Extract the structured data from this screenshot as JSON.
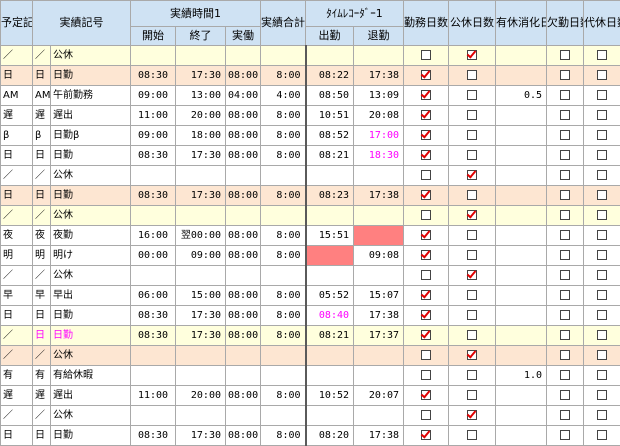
{
  "headers": {
    "plan": "予定記号",
    "actual": "実績記号",
    "time_group": "実績時間1",
    "start": "開始",
    "end": "終了",
    "work": "実働",
    "total": "実績合計",
    "recorder": "ﾀｲﾑﾚｺｰﾀﾞｰ1",
    "clock_in": "出勤",
    "clock_out": "退勤",
    "work_days": "勤務日数",
    "holiday_days": "公休日数",
    "paid_leave": "有休消化日数",
    "absent_days": "欠勤日数",
    "sub_days": "代休日数"
  },
  "rows": [
    {
      "bg": "y",
      "plan": "／",
      "code": "／",
      "name": "公休",
      "start": "",
      "end": "",
      "work": "",
      "total": "",
      "in": "",
      "out": "",
      "paid": "",
      "cb": [
        false,
        true,
        false,
        false
      ]
    },
    {
      "bg": "o",
      "plan": "日",
      "code": "日",
      "name": "日勤",
      "start": "08:30",
      "end": "17:30",
      "work": "08:00",
      "total": "8:00",
      "in": "08:22",
      "out": "17:38",
      "paid": "",
      "cb": [
        true,
        false,
        false,
        false
      ]
    },
    {
      "bg": "w",
      "plan": "AM",
      "code": "AM",
      "name": "午前勤務",
      "start": "09:00",
      "end": "13:00",
      "work": "04:00",
      "total": "4:00",
      "in": "08:50",
      "out": "13:09",
      "paid": "0.5",
      "cb": [
        true,
        false,
        false,
        false
      ]
    },
    {
      "bg": "w",
      "plan": "遅",
      "code": "遅",
      "name": "遅出",
      "start": "11:00",
      "end": "20:00",
      "work": "08:00",
      "total": "8:00",
      "in": "10:51",
      "out": "20:08",
      "paid": "",
      "cb": [
        true,
        false,
        false,
        false
      ]
    },
    {
      "bg": "w",
      "plan": "β",
      "code": "β",
      "name": "日勤β",
      "start": "09:00",
      "end": "18:00",
      "work": "08:00",
      "total": "8:00",
      "in": "08:52",
      "out": "17:00",
      "outMagenta": true,
      "paid": "",
      "cb": [
        true,
        false,
        false,
        false
      ]
    },
    {
      "bg": "w",
      "plan": "日",
      "code": "日",
      "name": "日勤",
      "start": "08:30",
      "end": "17:30",
      "work": "08:00",
      "total": "8:00",
      "in": "08:21",
      "out": "18:30",
      "outMagenta": true,
      "paid": "",
      "cb": [
        true,
        false,
        false,
        false
      ]
    },
    {
      "bg": "w",
      "plan": "／",
      "code": "／",
      "name": "公休",
      "start": "",
      "end": "",
      "work": "",
      "total": "",
      "in": "",
      "out": "",
      "paid": "",
      "cb": [
        false,
        true,
        false,
        false
      ]
    },
    {
      "bg": "o",
      "plan": "日",
      "code": "日",
      "name": "日勤",
      "start": "08:30",
      "end": "17:30",
      "work": "08:00",
      "total": "8:00",
      "in": "08:23",
      "out": "17:38",
      "paid": "",
      "cb": [
        true,
        false,
        false,
        false
      ]
    },
    {
      "bg": "y",
      "plan": "／",
      "code": "／",
      "name": "公休",
      "start": "",
      "end": "",
      "work": "",
      "total": "",
      "in": "",
      "out": "",
      "paid": "",
      "cb": [
        false,
        true,
        false,
        false
      ]
    },
    {
      "bg": "w",
      "plan": "夜",
      "code": "夜",
      "name": "夜勤",
      "start": "16:00",
      "end": "翌00:00",
      "work": "08:00",
      "total": "8:00",
      "in": "15:51",
      "out": "",
      "outRed": true,
      "paid": "",
      "cb": [
        true,
        false,
        false,
        false
      ]
    },
    {
      "bg": "w",
      "plan": "明",
      "code": "明",
      "name": "明け",
      "start": "00:00",
      "end": "09:00",
      "work": "08:00",
      "total": "8:00",
      "in": "",
      "inRed": true,
      "out": "09:08",
      "paid": "",
      "cb": [
        true,
        false,
        false,
        false
      ]
    },
    {
      "bg": "w",
      "plan": "／",
      "code": "／",
      "name": "公休",
      "start": "",
      "end": "",
      "work": "",
      "total": "",
      "in": "",
      "out": "",
      "paid": "",
      "cb": [
        false,
        true,
        false,
        false
      ]
    },
    {
      "bg": "w",
      "plan": "早",
      "code": "早",
      "name": "早出",
      "start": "06:00",
      "end": "15:00",
      "work": "08:00",
      "total": "8:00",
      "in": "05:52",
      "out": "15:07",
      "paid": "",
      "cb": [
        true,
        false,
        false,
        false
      ]
    },
    {
      "bg": "w",
      "plan": "日",
      "code": "日",
      "name": "日勤",
      "start": "08:30",
      "end": "17:30",
      "work": "08:00",
      "total": "8:00",
      "in": "08:40",
      "inMagenta": true,
      "out": "17:38",
      "paid": "",
      "cb": [
        true,
        false,
        false,
        false
      ]
    },
    {
      "bg": "y",
      "plan": "／",
      "code": "日",
      "codeMagenta": true,
      "name": "日勤",
      "nameMagenta": true,
      "start": "08:30",
      "end": "17:30",
      "work": "08:00",
      "total": "8:00",
      "in": "08:21",
      "out": "17:37",
      "paid": "",
      "cb": [
        true,
        false,
        false,
        false
      ]
    },
    {
      "bg": "o",
      "plan": "／",
      "code": "／",
      "name": "公休",
      "start": "",
      "end": "",
      "work": "",
      "total": "",
      "in": "",
      "out": "",
      "paid": "",
      "cb": [
        false,
        true,
        false,
        false
      ]
    },
    {
      "bg": "w",
      "plan": "有",
      "code": "有",
      "name": "有給休暇",
      "start": "",
      "end": "",
      "work": "",
      "total": "",
      "in": "",
      "out": "",
      "paid": "1.0",
      "cb": [
        false,
        false,
        false,
        false
      ]
    },
    {
      "bg": "w",
      "plan": "遅",
      "code": "遅",
      "name": "遅出",
      "start": "11:00",
      "end": "20:00",
      "work": "08:00",
      "total": "8:00",
      "in": "10:52",
      "out": "20:07",
      "paid": "",
      "cb": [
        true,
        false,
        false,
        false
      ]
    },
    {
      "bg": "w",
      "plan": "／",
      "code": "／",
      "name": "公休",
      "start": "",
      "end": "",
      "work": "",
      "total": "",
      "in": "",
      "out": "",
      "paid": "",
      "cb": [
        false,
        true,
        false,
        false
      ]
    },
    {
      "bg": "w",
      "plan": "日",
      "code": "日",
      "name": "日勤",
      "start": "08:30",
      "end": "17:30",
      "work": "08:00",
      "total": "8:00",
      "in": "08:20",
      "out": "17:38",
      "paid": "",
      "cb": [
        true,
        false,
        false,
        false
      ]
    }
  ]
}
